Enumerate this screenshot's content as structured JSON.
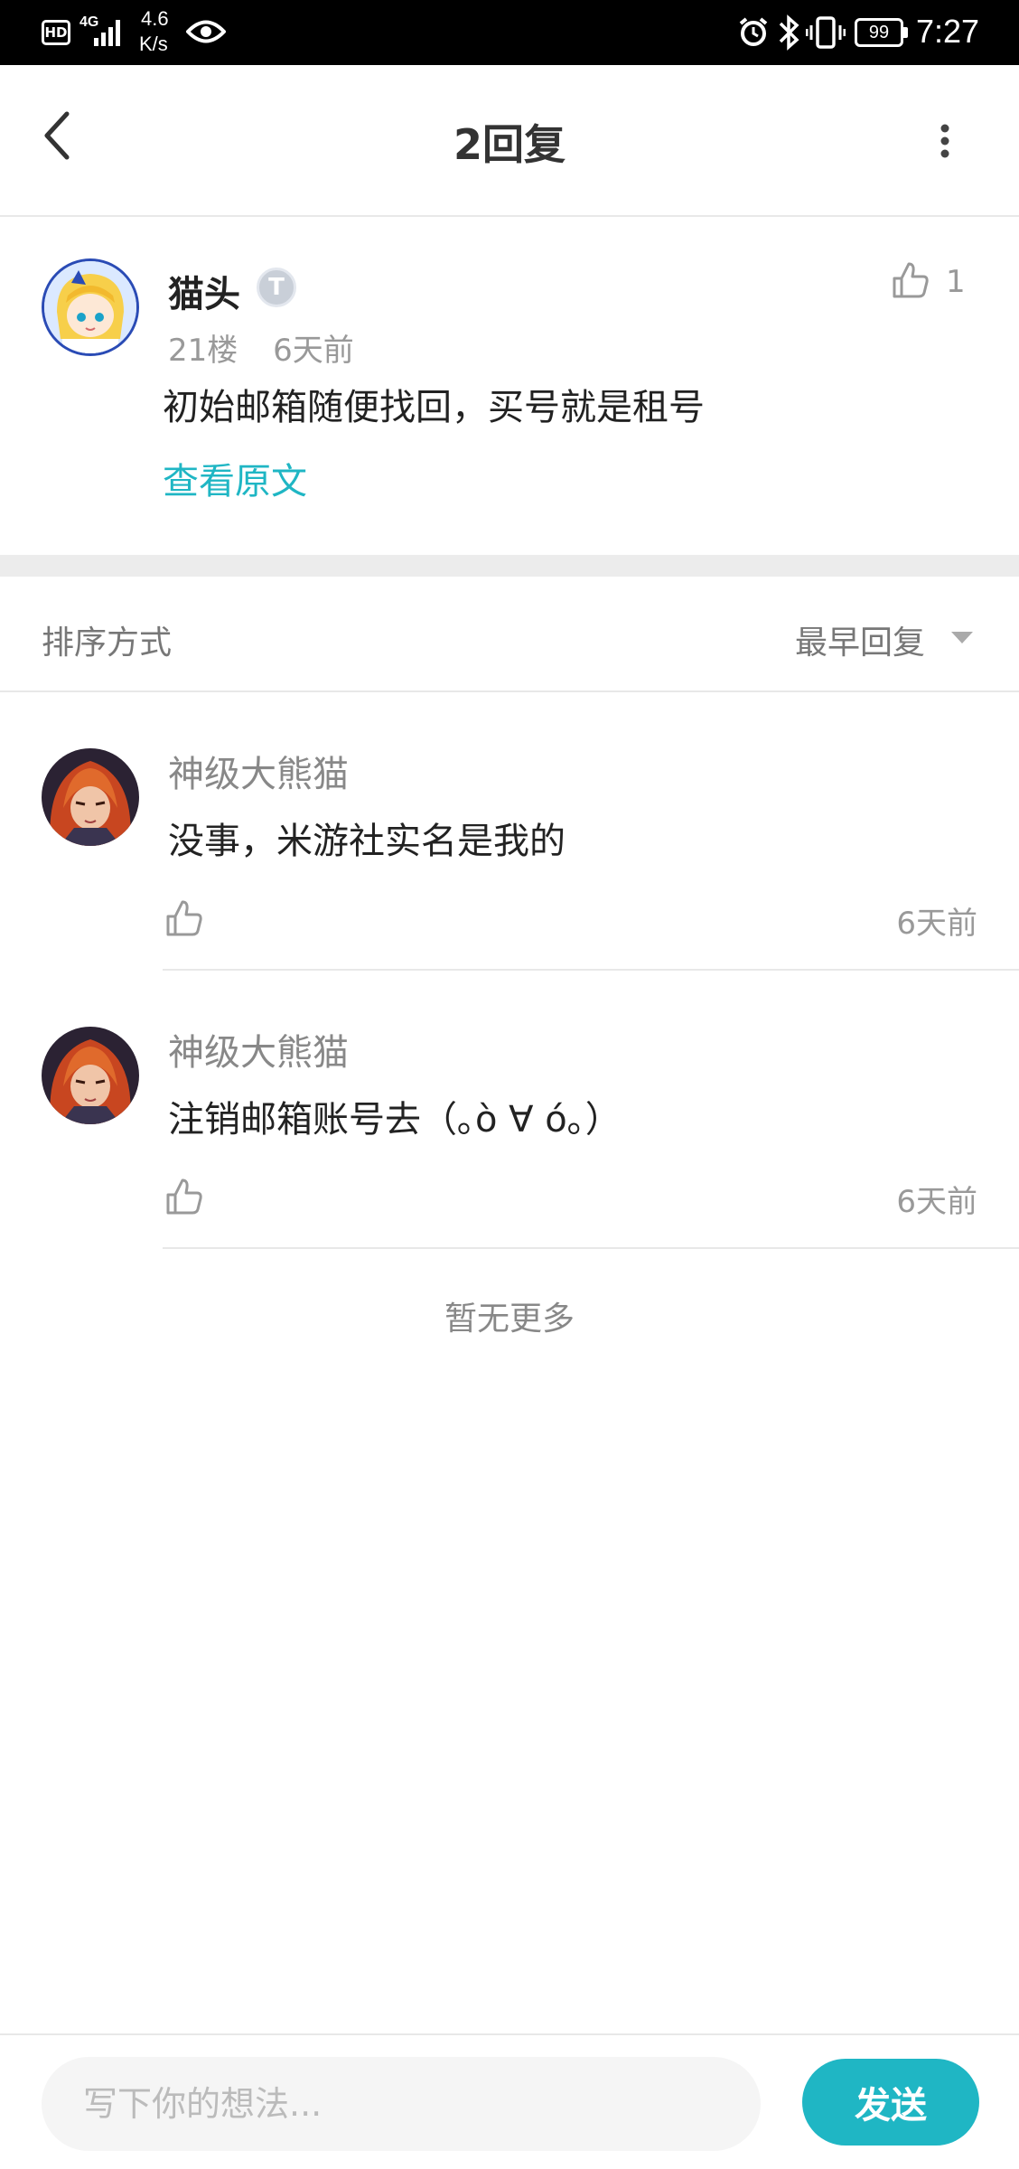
{
  "status_bar": {
    "hd": "HD",
    "network": "4G",
    "speed_value": "4.6",
    "speed_unit": "K/s",
    "battery": "99",
    "time": "7:27"
  },
  "header": {
    "title": "2回复"
  },
  "main_comment": {
    "username": "猫头",
    "badge": "T",
    "floor": "21楼",
    "time": "6天前",
    "content": "初始邮箱随便找回，买号就是租号",
    "view_original": "查看原文",
    "like_count": "1"
  },
  "sort": {
    "label": "排序方式",
    "value": "最早回复"
  },
  "replies": [
    {
      "username": "神级大熊猫",
      "content": "没事，米游社实名是我的",
      "time": "6天前"
    },
    {
      "username": "神级大熊猫",
      "content": "注销邮箱账号去（｡ò ∀ ó｡）",
      "time": "6天前"
    }
  ],
  "no_more": "暂无更多",
  "input": {
    "placeholder": "写下你的想法...",
    "send_label": "发送"
  },
  "colors": {
    "accent": "#1fb6c4",
    "muted_text": "#999999",
    "divider": "#e8e8e8"
  }
}
